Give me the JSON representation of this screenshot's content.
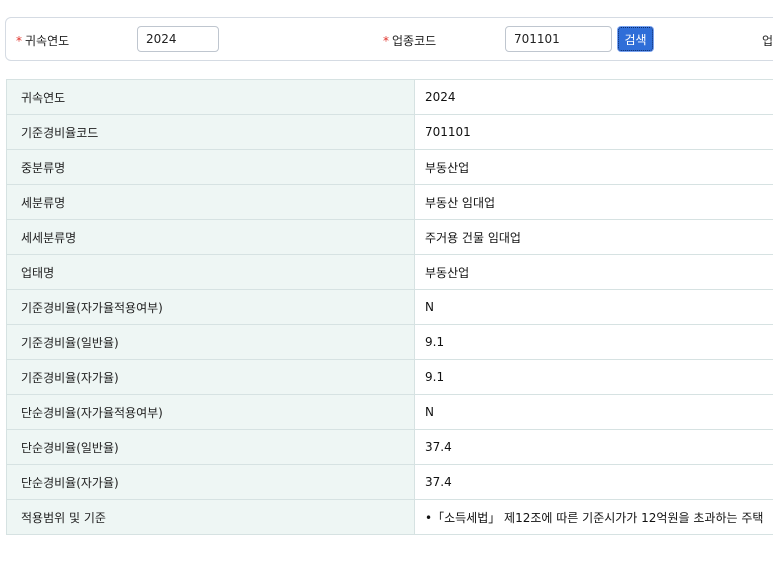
{
  "search": {
    "year_label": "귀속연도",
    "year_value": "2024",
    "code_label": "업종코드",
    "code_value": "701101",
    "search_button": "검색",
    "clipped_label": "업",
    "required_mark": "*"
  },
  "details": [
    {
      "label": "귀속연도",
      "value": "2024"
    },
    {
      "label": "기준경비율코드",
      "value": "701101"
    },
    {
      "label": "중분류명",
      "value": "부동산업"
    },
    {
      "label": "세분류명",
      "value": "부동산 임대업"
    },
    {
      "label": "세세분류명",
      "value": "주거용 건물 임대업"
    },
    {
      "label": "업태명",
      "value": "부동산업"
    },
    {
      "label": "기준경비율(자가율적용여부)",
      "value": "N"
    },
    {
      "label": "기준경비율(일반율)",
      "value": "9.1"
    },
    {
      "label": "기준경비율(자가율)",
      "value": "9.1"
    },
    {
      "label": "단순경비율(자가율적용여부)",
      "value": "N"
    },
    {
      "label": "단순경비율(일반율)",
      "value": "37.4"
    },
    {
      "label": "단순경비율(자가율)",
      "value": "37.4"
    },
    {
      "label": "적용범위 및 기준",
      "value": "•「소득세법」 제12조에 따른 기준시가가 12억원을 초과하는 주택"
    }
  ]
}
